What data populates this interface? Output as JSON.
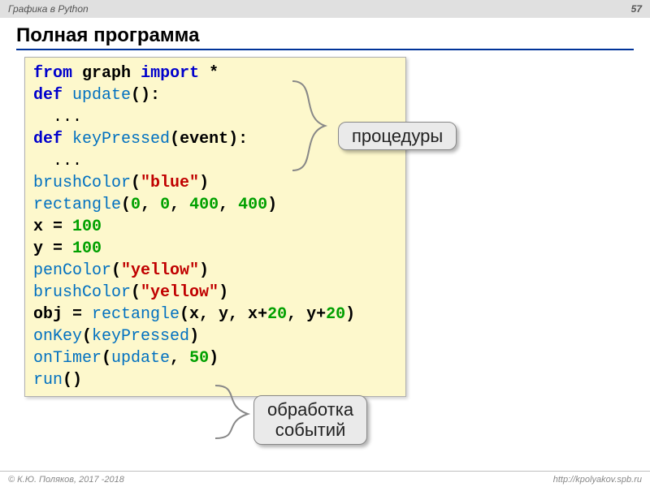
{
  "header": {
    "title": "Графика в Python",
    "page": "57"
  },
  "slide": {
    "heading": "Полная программа"
  },
  "code": {
    "l1_from": "from",
    "l1_graph": "graph",
    "l1_import": "import",
    "l1_star": "*",
    "l2_def": "def",
    "l2_fn": "update",
    "l2_rest": "():",
    "l3": "...",
    "l4_def": "def",
    "l4_fn": "keyPressed",
    "l4_rest": "(event):",
    "l5": "...",
    "l6_fn": "brushColor",
    "l6_open": "(",
    "l6_str": "\"blue\"",
    "l6_close": ")",
    "l7_fn": "rectangle",
    "l7_open": "(",
    "l7_n1": "0",
    "l7_n2": "0",
    "l7_n3": "400",
    "l7_n4": "400",
    "l7_close": ")",
    "l7_comma": ", ",
    "l8_a": "x = ",
    "l8_n": "100",
    "l9_a": "y = ",
    "l9_n": "100",
    "l10_fn": "penColor",
    "l10_open": "(",
    "l10_str": "\"yellow\"",
    "l10_close": ")",
    "l11_fn": "brushColor",
    "l11_open": "(",
    "l11_str": "\"yellow\"",
    "l11_close": ")",
    "l12_a": "obj = ",
    "l12_fn": "rectangle",
    "l12_open": "(x, y, x+",
    "l12_n1": "20",
    "l12_mid": ", y+",
    "l12_n2": "20",
    "l12_close": ")",
    "l13_fn": "onKey",
    "l13_open": "(",
    "l13_arg": "keyPressed",
    "l13_close": ")",
    "l14_fn": "onTimer",
    "l14_open": "(",
    "l14_arg": "update",
    "l14_mid": ", ",
    "l14_n": "50",
    "l14_close": ")",
    "l15_fn": "run",
    "l15_rest": "()"
  },
  "callouts": {
    "c1": "процедуры",
    "c2_l1": "обработка",
    "c2_l2": "событий"
  },
  "footer": {
    "left": "© К.Ю. Поляков, 2017 -2018",
    "right": "http://kpolyakov.spb.ru"
  }
}
